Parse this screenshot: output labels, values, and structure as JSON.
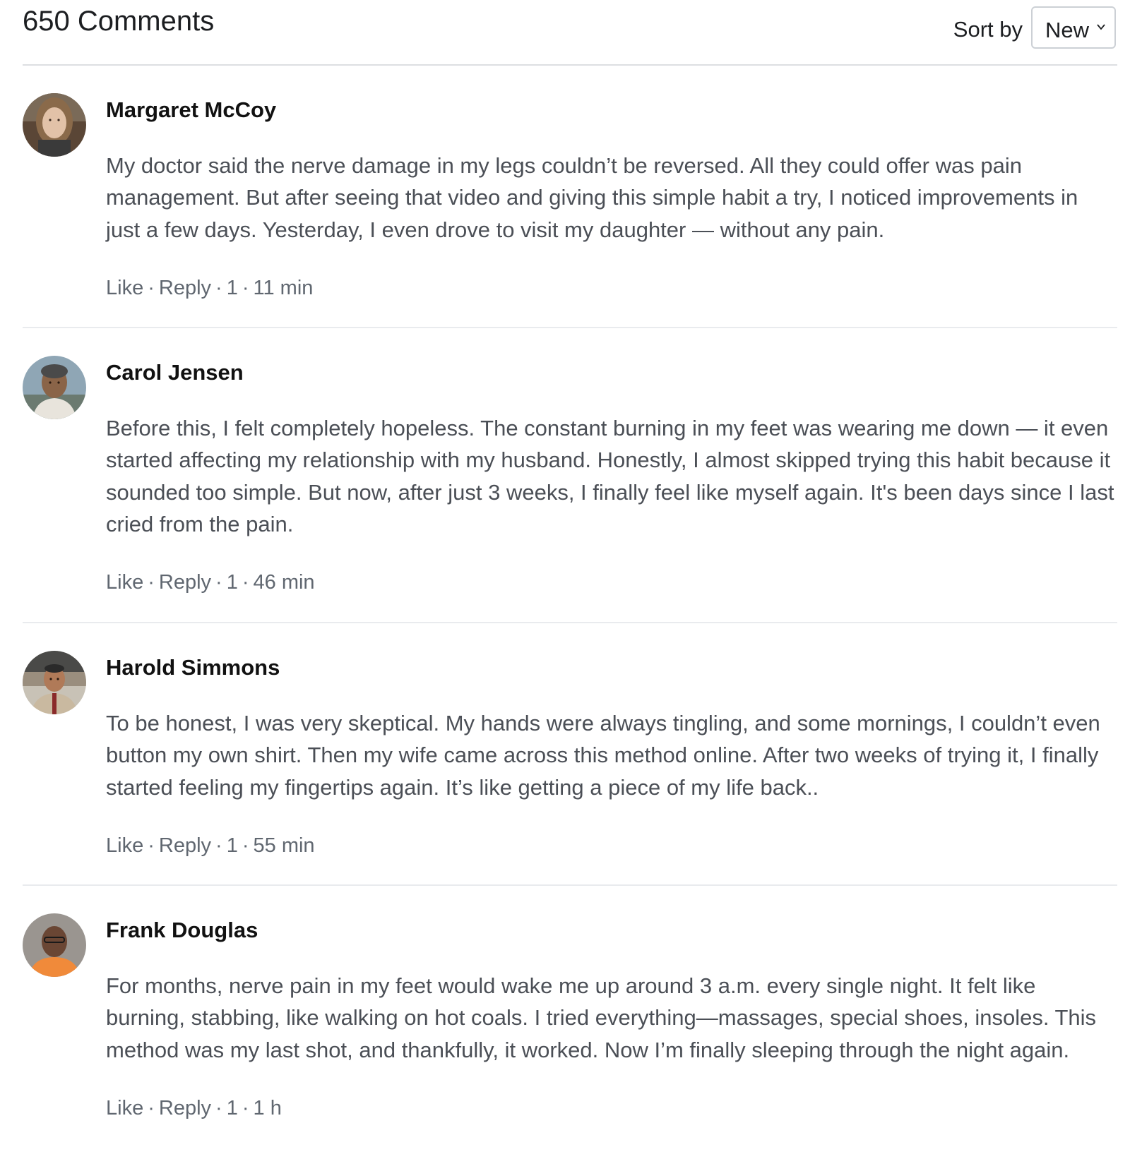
{
  "header": {
    "count_label": "650 Comments",
    "sort_label": "Sort by",
    "sort_value": "New"
  },
  "comments": [
    {
      "name": "Margaret McCoy",
      "text": "My doctor said the nerve damage in my legs couldn’t be reversed. All they could offer was pain management. But after seeing that video and giving this simple habit a try, I noticed improvements in just a few days. Yesterday, I even drove to visit my daughter — without any pain.",
      "like": "Like",
      "reply": "Reply",
      "likes": "1",
      "time": "11 min"
    },
    {
      "name": "Carol Jensen",
      "text": "Before this, I felt completely hopeless. The constant burning in my feet was wearing me down — it even started affecting my relationship with my husband. Honestly, I almost skipped trying this habit because it sounded too simple. But now, after just 3 weeks, I finally feel like myself again. It's been days since I last cried from the pain.",
      "like": "Like",
      "reply": "Reply",
      "likes": "1",
      "time": "46 min"
    },
    {
      "name": "Harold Simmons",
      "text": "To be honest, I was very skeptical. My hands were always tingling, and some mornings, I couldn’t even button my own shirt. Then my wife came across this method online. After two weeks of trying it, I finally started feeling my fingertips again. It’s like getting a piece of my life back..",
      "like": "Like",
      "reply": "Reply",
      "likes": "1",
      "time": "55 min"
    },
    {
      "name": "Frank Douglas",
      "text": "For months, nerve pain in my feet would wake me up around 3 a.m. every single night. It felt like burning, stabbing, like walking on hot coals. I tried everything—massages, special shoes, insoles. This method was my last shot, and thankfully, it worked. Now I’m finally sleeping through the night again.",
      "like": "Like",
      "reply": "Reply",
      "likes": "1",
      "time": "1 h"
    }
  ]
}
